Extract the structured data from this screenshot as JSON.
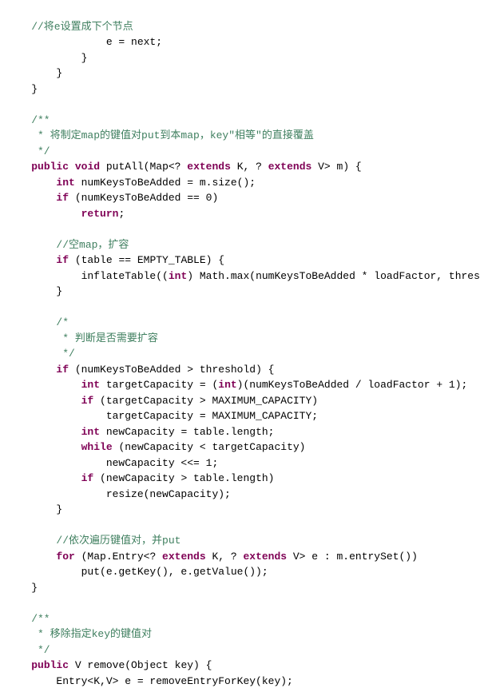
{
  "code": {
    "lines": [
      {
        "id": 1,
        "tokens": [
          {
            "text": "    //将e设置成下个节点",
            "class": "comment-cn"
          }
        ]
      },
      {
        "id": 2,
        "tokens": [
          {
            "text": "                e = next;",
            "class": "normal"
          }
        ]
      },
      {
        "id": 3,
        "tokens": [
          {
            "text": "            }",
            "class": "normal"
          }
        ]
      },
      {
        "id": 4,
        "tokens": [
          {
            "text": "        }",
            "class": "normal"
          }
        ]
      },
      {
        "id": 5,
        "tokens": [
          {
            "text": "    }",
            "class": "normal"
          }
        ]
      },
      {
        "id": 6,
        "tokens": []
      },
      {
        "id": 7,
        "tokens": [
          {
            "text": "    /**",
            "class": "comment"
          }
        ]
      },
      {
        "id": 8,
        "tokens": [
          {
            "text": "     * 将制定map的键值对put到本map，key\"相等\"的直接覆盖",
            "class": "comment-cn"
          }
        ]
      },
      {
        "id": 9,
        "tokens": [
          {
            "text": "     */",
            "class": "comment"
          }
        ]
      },
      {
        "id": 10,
        "tokens": [
          {
            "text": "    ",
            "class": "normal"
          },
          {
            "text": "public",
            "class": "keyword"
          },
          {
            "text": " ",
            "class": "normal"
          },
          {
            "text": "void",
            "class": "keyword"
          },
          {
            "text": " putAll(Map<? ",
            "class": "normal"
          },
          {
            "text": "extends",
            "class": "keyword"
          },
          {
            "text": " K, ? ",
            "class": "normal"
          },
          {
            "text": "extends",
            "class": "keyword"
          },
          {
            "text": " V> m) {",
            "class": "normal"
          }
        ]
      },
      {
        "id": 11,
        "tokens": [
          {
            "text": "        ",
            "class": "normal"
          },
          {
            "text": "int",
            "class": "keyword"
          },
          {
            "text": " numKeysToBeAdded = m.size();",
            "class": "normal"
          }
        ]
      },
      {
        "id": 12,
        "tokens": [
          {
            "text": "        ",
            "class": "normal"
          },
          {
            "text": "if",
            "class": "keyword"
          },
          {
            "text": " (numKeysToBeAdded == 0)",
            "class": "normal"
          }
        ]
      },
      {
        "id": 13,
        "tokens": [
          {
            "text": "            ",
            "class": "normal"
          },
          {
            "text": "return",
            "class": "keyword"
          },
          {
            "text": ";",
            "class": "normal"
          }
        ]
      },
      {
        "id": 14,
        "tokens": []
      },
      {
        "id": 15,
        "tokens": [
          {
            "text": "        //空map，扩容",
            "class": "comment-cn"
          }
        ]
      },
      {
        "id": 16,
        "tokens": [
          {
            "text": "        ",
            "class": "normal"
          },
          {
            "text": "if",
            "class": "keyword"
          },
          {
            "text": " (table == EMPTY_TABLE) {",
            "class": "normal"
          }
        ]
      },
      {
        "id": 17,
        "tokens": [
          {
            "text": "            inflateTable((",
            "class": "normal"
          },
          {
            "text": "int",
            "class": "keyword"
          },
          {
            "text": ") Math.max(numKeysToBeAdded * loadFactor, threshold));",
            "class": "normal"
          }
        ]
      },
      {
        "id": 18,
        "tokens": [
          {
            "text": "        }",
            "class": "normal"
          }
        ]
      },
      {
        "id": 19,
        "tokens": []
      },
      {
        "id": 20,
        "tokens": [
          {
            "text": "        /*",
            "class": "comment"
          }
        ]
      },
      {
        "id": 21,
        "tokens": [
          {
            "text": "         * 判断是否需要扩容",
            "class": "comment-cn"
          }
        ]
      },
      {
        "id": 22,
        "tokens": [
          {
            "text": "         */",
            "class": "comment"
          }
        ]
      },
      {
        "id": 23,
        "tokens": [
          {
            "text": "        ",
            "class": "normal"
          },
          {
            "text": "if",
            "class": "keyword"
          },
          {
            "text": " (numKeysToBeAdded > threshold) {",
            "class": "normal"
          }
        ]
      },
      {
        "id": 24,
        "tokens": [
          {
            "text": "            ",
            "class": "normal"
          },
          {
            "text": "int",
            "class": "keyword"
          },
          {
            "text": " targetCapacity = (",
            "class": "normal"
          },
          {
            "text": "int",
            "class": "keyword"
          },
          {
            "text": ")(numKeysToBeAdded / loadFactor + 1);",
            "class": "normal"
          }
        ]
      },
      {
        "id": 25,
        "tokens": [
          {
            "text": "            ",
            "class": "normal"
          },
          {
            "text": "if",
            "class": "keyword"
          },
          {
            "text": " (targetCapacity > MAXIMUM_CAPACITY)",
            "class": "normal"
          }
        ]
      },
      {
        "id": 26,
        "tokens": [
          {
            "text": "                targetCapacity = MAXIMUM_CAPACITY;",
            "class": "normal"
          }
        ]
      },
      {
        "id": 27,
        "tokens": [
          {
            "text": "            ",
            "class": "normal"
          },
          {
            "text": "int",
            "class": "keyword"
          },
          {
            "text": " newCapacity = table.length;",
            "class": "normal"
          }
        ]
      },
      {
        "id": 28,
        "tokens": [
          {
            "text": "            ",
            "class": "normal"
          },
          {
            "text": "while",
            "class": "keyword"
          },
          {
            "text": " (newCapacity < targetCapacity)",
            "class": "normal"
          }
        ]
      },
      {
        "id": 29,
        "tokens": [
          {
            "text": "                newCapacity <<= 1;",
            "class": "normal"
          }
        ]
      },
      {
        "id": 30,
        "tokens": [
          {
            "text": "            ",
            "class": "normal"
          },
          {
            "text": "if",
            "class": "keyword"
          },
          {
            "text": " (newCapacity > table.length)",
            "class": "normal"
          }
        ]
      },
      {
        "id": 31,
        "tokens": [
          {
            "text": "                resize(newCapacity);",
            "class": "normal"
          }
        ]
      },
      {
        "id": 32,
        "tokens": [
          {
            "text": "        }",
            "class": "normal"
          }
        ]
      },
      {
        "id": 33,
        "tokens": []
      },
      {
        "id": 34,
        "tokens": [
          {
            "text": "        //依次遍历键值对，并put",
            "class": "comment-cn"
          }
        ]
      },
      {
        "id": 35,
        "tokens": [
          {
            "text": "        ",
            "class": "normal"
          },
          {
            "text": "for",
            "class": "keyword"
          },
          {
            "text": " (Map.Entry<? ",
            "class": "normal"
          },
          {
            "text": "extends",
            "class": "keyword"
          },
          {
            "text": " K, ? ",
            "class": "normal"
          },
          {
            "text": "extends",
            "class": "keyword"
          },
          {
            "text": " V> e : m.entrySet())",
            "class": "normal"
          }
        ]
      },
      {
        "id": 36,
        "tokens": [
          {
            "text": "            put(e.getKey(), e.getValue());",
            "class": "normal"
          }
        ]
      },
      {
        "id": 37,
        "tokens": [
          {
            "text": "    }",
            "class": "normal"
          }
        ]
      },
      {
        "id": 38,
        "tokens": []
      },
      {
        "id": 39,
        "tokens": [
          {
            "text": "    /**",
            "class": "comment"
          }
        ]
      },
      {
        "id": 40,
        "tokens": [
          {
            "text": "     * 移除指定key的键值对",
            "class": "comment-cn"
          }
        ]
      },
      {
        "id": 41,
        "tokens": [
          {
            "text": "     */",
            "class": "comment"
          }
        ]
      },
      {
        "id": 42,
        "tokens": [
          {
            "text": "    ",
            "class": "normal"
          },
          {
            "text": "public",
            "class": "keyword"
          },
          {
            "text": " V remove(Object key) {",
            "class": "normal"
          }
        ]
      },
      {
        "id": 43,
        "tokens": [
          {
            "text": "        Entry<K,V> e = removeEntryForKey(key);",
            "class": "normal"
          }
        ]
      }
    ]
  }
}
